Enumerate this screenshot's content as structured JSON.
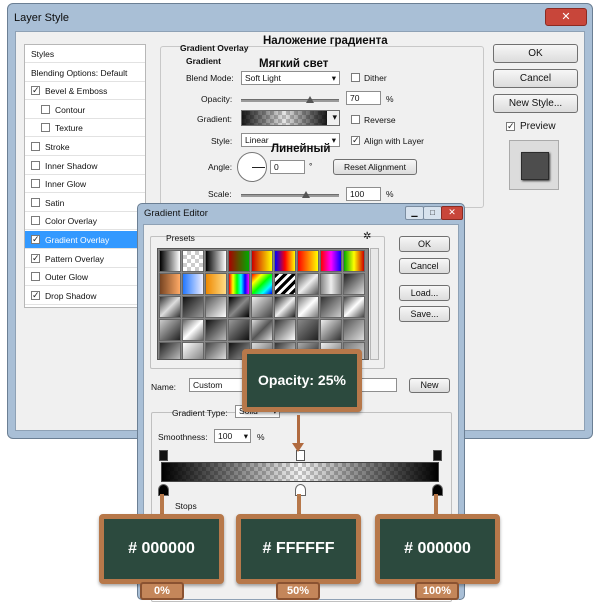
{
  "layer_style": {
    "title": "Layer Style",
    "close": "✕",
    "styles_items": [
      {
        "label": "Styles",
        "checkbox": false,
        "checked": false
      },
      {
        "label": "Blending Options: Default",
        "checkbox": false,
        "checked": false
      },
      {
        "label": "Bevel & Emboss",
        "checkbox": true,
        "checked": true
      },
      {
        "label": "Contour",
        "checkbox": true,
        "checked": false,
        "indent": true
      },
      {
        "label": "Texture",
        "checkbox": true,
        "checked": false,
        "indent": true
      },
      {
        "label": "Stroke",
        "checkbox": true,
        "checked": false
      },
      {
        "label": "Inner Shadow",
        "checkbox": true,
        "checked": false
      },
      {
        "label": "Inner Glow",
        "checkbox": true,
        "checked": false
      },
      {
        "label": "Satin",
        "checkbox": true,
        "checked": false
      },
      {
        "label": "Color Overlay",
        "checkbox": true,
        "checked": false
      },
      {
        "label": "Gradient Overlay",
        "checkbox": true,
        "checked": true,
        "selected": true
      },
      {
        "label": "Pattern Overlay",
        "checkbox": true,
        "checked": true
      },
      {
        "label": "Outer Glow",
        "checkbox": true,
        "checked": false
      },
      {
        "label": "Drop Shadow",
        "checkbox": true,
        "checked": true
      }
    ],
    "buttons": {
      "ok": "OK",
      "cancel": "Cancel",
      "new_style": "New Style...",
      "preview": "Preview"
    },
    "preview_checked": true,
    "gradient_overlay": {
      "section_title": "Gradient Overlay",
      "group_title": "Gradient",
      "blend_mode_label": "Blend Mode:",
      "blend_mode_value": "Soft Light",
      "dither_label": "Dither",
      "opacity_label": "Opacity:",
      "opacity_value": "70",
      "opacity_unit": "%",
      "opacity_fraction": 0.7,
      "gradient_label": "Gradient:",
      "reverse_label": "Reverse",
      "style_label": "Style:",
      "style_value": "Linear",
      "align_label": "Align with Layer",
      "angle_label": "Angle:",
      "angle_value": "0",
      "angle_unit": "°",
      "reset_alignment": "Reset Alignment",
      "scale_label": "Scale:",
      "scale_value": "100",
      "scale_unit": "%",
      "scale_fraction": 0.66
    }
  },
  "annotations": {
    "gradient_overlay_ru": "Наложение градиента",
    "soft_light_ru": "Мягкий свет",
    "linear_ru": "Линейный"
  },
  "gradient_editor": {
    "title": "Gradient Editor",
    "presets_label": "Presets",
    "buttons": {
      "ok": "OK",
      "cancel": "Cancel",
      "load": "Load...",
      "save": "Save..."
    },
    "name_label": "Name:",
    "name_value": "Custom",
    "new_button": "New",
    "gradient_type_label": "Gradient Type:",
    "gradient_type_value": "Solid",
    "smoothness_label": "Smoothness:",
    "smoothness_value": "100",
    "smoothness_unit": "%",
    "stops_label": "Stops"
  },
  "callouts": {
    "opacity": "Opacity: 25%",
    "stop_colors": [
      "# 000000",
      "# FFFFFF",
      "# 000000"
    ],
    "stop_positions": [
      "0%",
      "50%",
      "100%"
    ]
  },
  "colors": {
    "selection": "#3399ff",
    "board": "#2c4a3e",
    "frame": "#b7784a",
    "window": "#a9bfd6"
  }
}
